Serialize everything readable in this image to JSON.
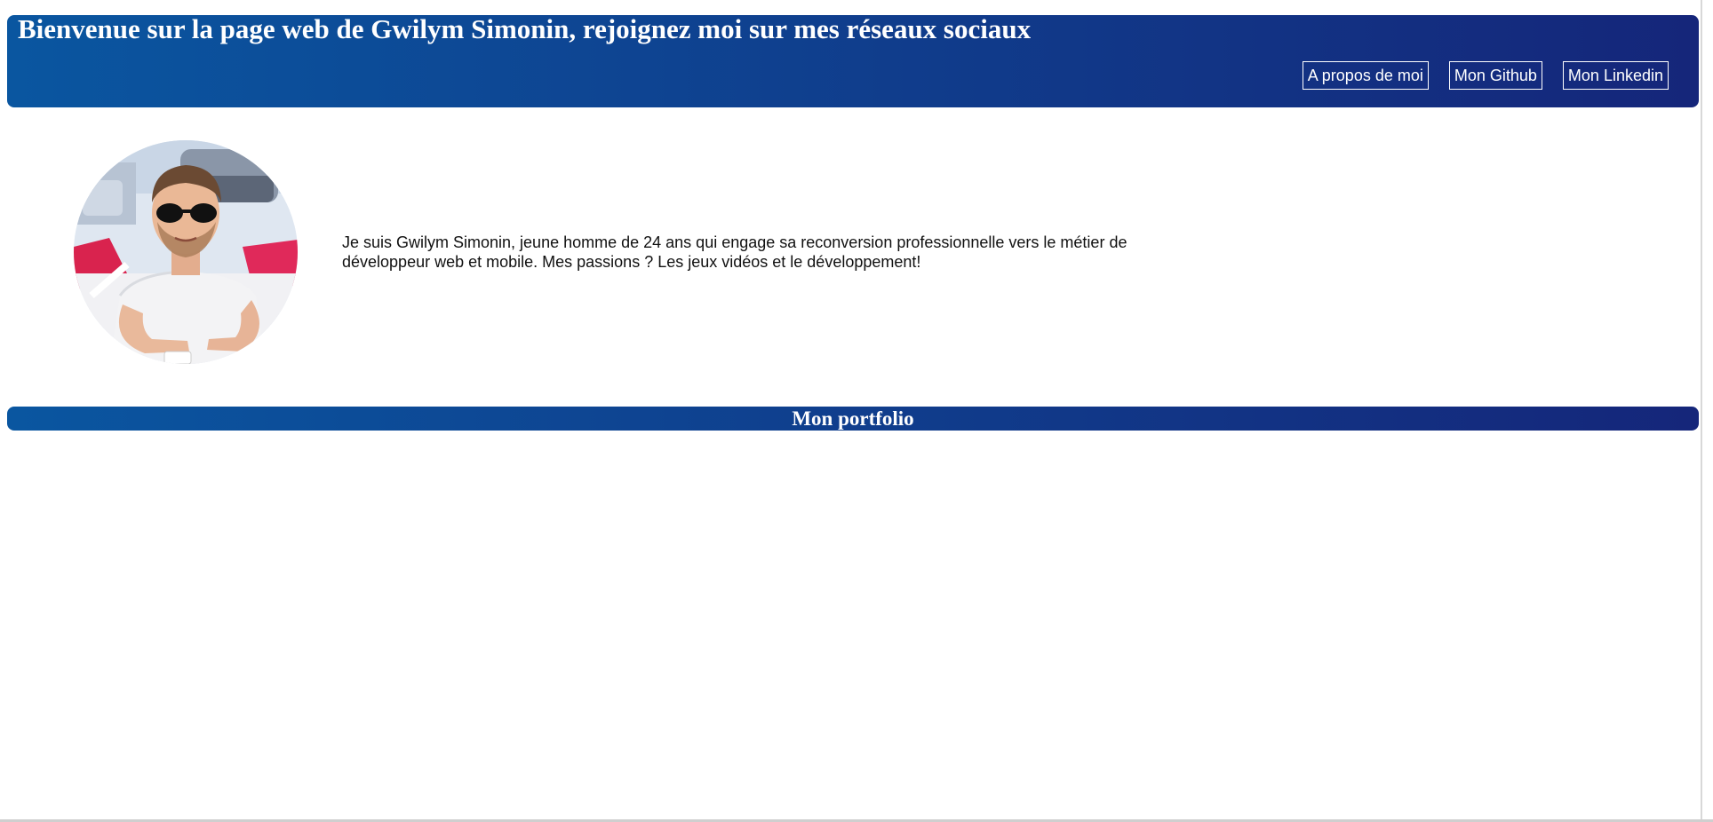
{
  "header": {
    "title": "Bienvenue sur la page web de Gwilym Simonin, rejoignez moi sur mes réseaux sociaux",
    "nav": [
      {
        "label": "A propos de moi"
      },
      {
        "label": "Mon Github"
      },
      {
        "label": "Mon Linkedin"
      }
    ]
  },
  "about": {
    "photo_alt": "Gwilym Simonin",
    "bio": "Je suis Gwilym Simonin, jeune homme de 24 ans qui engage sa reconversion professionnelle vers le métier de développeur web et mobile. Mes passions ? Les jeux vidéos et le développement!"
  },
  "portfolio": {
    "title": "Mon portfolio"
  },
  "colors": {
    "gradient_start": "#0a56a0",
    "gradient_end": "#15267a",
    "text_light": "#ffffff"
  }
}
